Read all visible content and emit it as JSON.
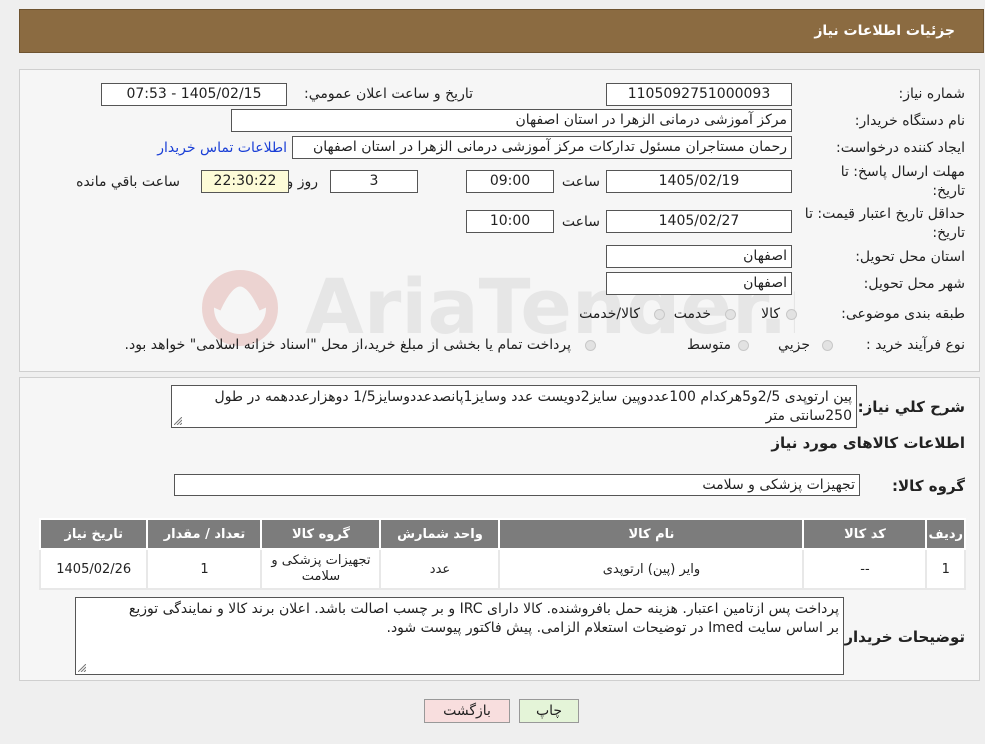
{
  "header": {
    "title": "جزئیات اطلاعات نیاز"
  },
  "form": {
    "need_number_label": "شماره نیاز:",
    "need_number": "1105092751000093",
    "announce_label": "تاریخ و ساعت اعلان عمومي:",
    "announce_value": "1405/02/15 - 07:53",
    "buyer_org_label": "نام دستگاه خریدار:",
    "buyer_org": "مرکز آموزشی درمانی الزهرا در استان اصفهان",
    "creator_label": "ایجاد کننده درخواست:",
    "creator": "رحمان مستاجران مسئول تدارکات مرکز آموزشی درمانی الزهرا در استان اصفهان",
    "contact_link": "اطلاعات تماس خریدار",
    "deadline_label_1": "مهلت ارسال پاسخ: تا",
    "deadline_label_2": "تاریخ:",
    "deadline_date": "1405/02/19",
    "time_label": "ساعت",
    "deadline_time": "09:00",
    "days_value": "3",
    "days_label": "روز و",
    "remaining_value": "22:30:22",
    "remaining_label": "ساعت باقي مانده",
    "validity_label_1": "حداقل تاریخ اعتبار قیمت: تا",
    "validity_label_2": "تاریخ:",
    "validity_date": "1405/02/27",
    "validity_time": "10:00",
    "province_label": "استان محل تحویل:",
    "province": "اصفهان",
    "city_label": "شهر محل تحویل:",
    "city": "اصفهان",
    "category_label": "طبقه بندی موضوعی:",
    "category_options": [
      "کالا",
      "خدمت",
      "کالا/خدمت"
    ],
    "process_label": "نوع فرآیند خرید :",
    "process_options": [
      "جزيي",
      "متوسط"
    ],
    "process_note": "پرداخت تمام یا بخشی از مبلغ خرید،از محل \"اسناد خزانه اسلامی\" خواهد بود."
  },
  "summary": {
    "label": "شرح كلي نياز:",
    "line1": "پین ارتوپدی 2/5و5هرکدام 100عددوپین سایز2دویست عدد وسایز1پانصدعددوسایز1/5 دوهزارعددهمه در طول",
    "line2": "250سانتی متر"
  },
  "goods": {
    "section_title": "اطلاعات کالاهای مورد نیاز",
    "group_label": "گروه کالا:",
    "group_value": "تجهیزات پزشکی و سلامت"
  },
  "table": {
    "headers": [
      "ردیف",
      "کد کالا",
      "نام کالا",
      "واحد شمارش",
      "گروه کالا",
      "تعداد / مقدار",
      "تاریخ نیاز"
    ],
    "rows": [
      [
        "1",
        "--",
        "وایر (پین) ارتوپدی",
        "عدد",
        "تجهیزات پزشکی و سلامت",
        "1",
        "1405/02/26"
      ]
    ]
  },
  "buyer_notes": {
    "label": "توضیحات خریدار:",
    "line1": "پرداخت پس ازتامین اعتبار. هزینه حمل بافروشنده. کالا دارای IRC و بر چسب اصالت باشد. اعلان برند کالا و نمایندگی توزیع",
    "line2": "بر اساس سایت Imed در توضیحات استعلام الزامی.  پیش فاکتور پیوست شود."
  },
  "buttons": {
    "print": "چاپ",
    "back": "بازگشت"
  },
  "colors": {
    "header": "#8b6b41",
    "table_header": "#7c7c7c",
    "print_btn": "#e4f4d8",
    "back_btn": "#f8dede",
    "link": "#1a3fd6"
  },
  "watermark": "AriaTender.neT"
}
